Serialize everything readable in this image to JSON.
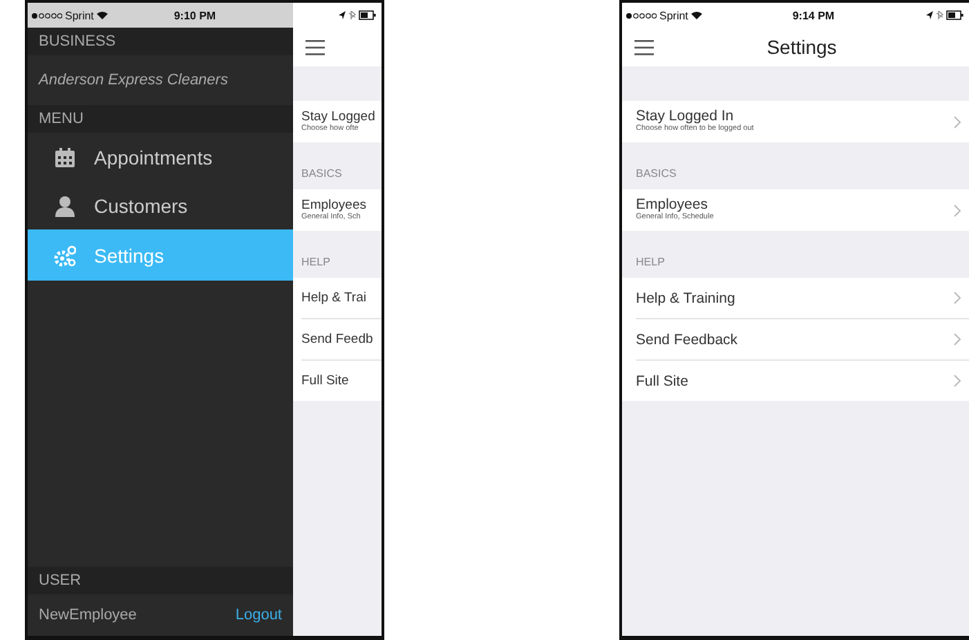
{
  "screens": [
    {
      "status_bar": {
        "carrier": "Sprint",
        "time": "9:10 PM"
      },
      "drawer": {
        "business_header": "BUSINESS",
        "business_name": "Anderson Express Cleaners",
        "menu_header": "MENU",
        "menu_items": [
          {
            "label": "Appointments",
            "selected": false
          },
          {
            "label": "Customers",
            "selected": false
          },
          {
            "label": "Settings",
            "selected": true
          }
        ],
        "user_header": "USER",
        "user_name": "NewEmployee",
        "logout": "Logout"
      },
      "main": {
        "show_chevrons": false,
        "sections": [
          {
            "rows": [
              {
                "title": "Stay Logged",
                "subtitle": "Choose how ofte"
              }
            ]
          },
          {
            "header": "BASICS",
            "rows": [
              {
                "title": "Employees",
                "subtitle": "General Info, Sch"
              }
            ]
          },
          {
            "header": "HELP",
            "rows": [
              {
                "title": "Help & Trai"
              },
              {
                "title": "Send Feedb"
              },
              {
                "title": "Full Site"
              }
            ]
          }
        ]
      }
    },
    {
      "status_bar": {
        "carrier": "Sprint",
        "time": "9:14 PM"
      },
      "main": {
        "title": "Settings",
        "show_chevrons": true,
        "sections": [
          {
            "rows": [
              {
                "title": "Stay Logged In",
                "subtitle": "Choose how often to be logged out"
              }
            ]
          },
          {
            "header": "BASICS",
            "rows": [
              {
                "title": "Employees",
                "subtitle": "General Info, Schedule"
              }
            ]
          },
          {
            "header": "HELP",
            "rows": [
              {
                "title": "Help & Training"
              },
              {
                "title": "Send Feedback"
              },
              {
                "title": "Full Site"
              }
            ]
          }
        ]
      }
    }
  ]
}
